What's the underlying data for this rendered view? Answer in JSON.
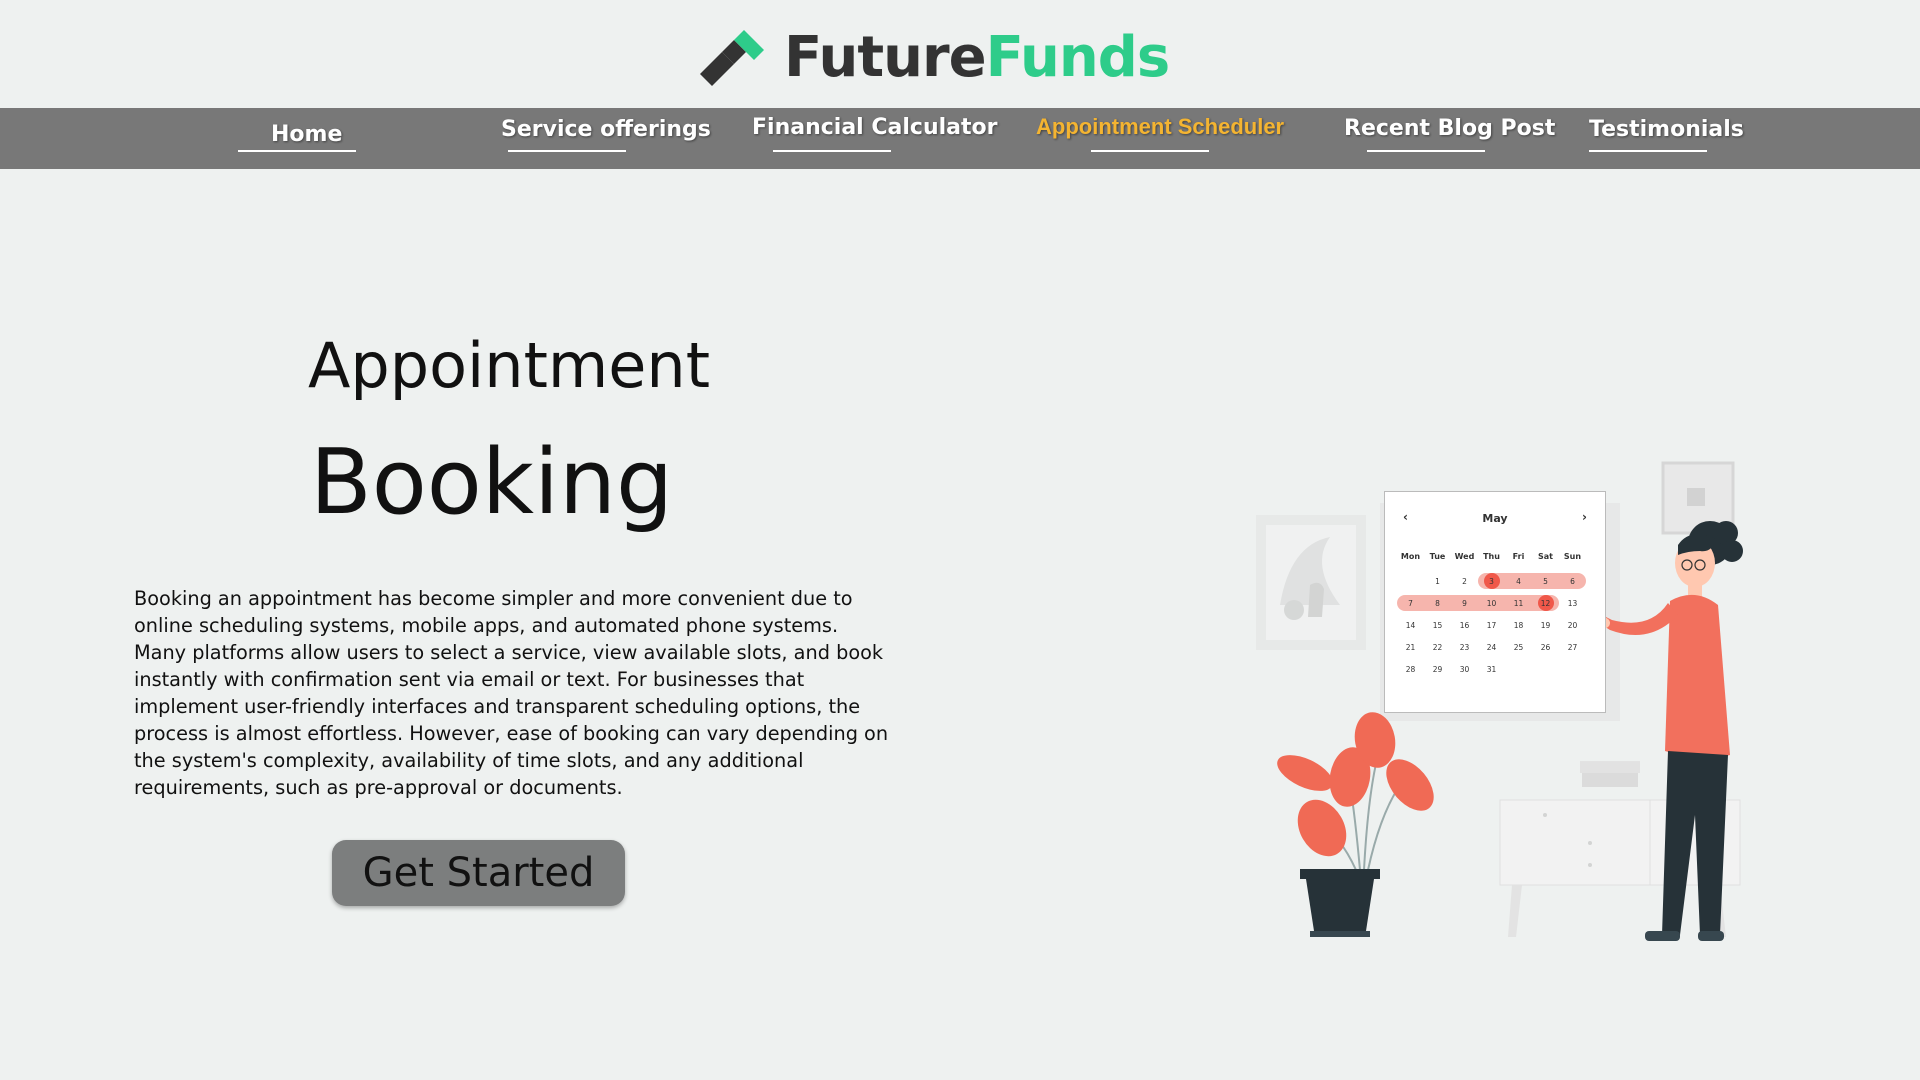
{
  "brand": {
    "name_part1": "Future",
    "name_part2": "Funds",
    "colors": {
      "dark": "#333333",
      "accent": "#2ecc8a",
      "nav_bg": "#787878",
      "nav_active": "#f4b431"
    }
  },
  "nav": {
    "items": [
      {
        "label": "Home",
        "active": false
      },
      {
        "label": "Service offerings",
        "active": false
      },
      {
        "label": "Financial Calculator",
        "active": false
      },
      {
        "label": "Appointment Scheduler",
        "active": true
      },
      {
        "label": "Recent Blog Post",
        "active": false
      },
      {
        "label": "Testimonials",
        "active": false
      }
    ]
  },
  "hero": {
    "title_line1": "Appointment",
    "title_line2": "Booking",
    "description": "Booking an appointment has become simpler and more convenient due to online scheduling systems, mobile apps, and automated phone systems. Many platforms allow users to select a service, view available slots, and book instantly with confirmation sent via email or text. For businesses that implement user-friendly interfaces and transparent scheduling options, the process is almost effortless. However, ease of booking can vary depending on the system's complexity, availability of time slots, and any additional requirements, such as pre-approval or documents.",
    "cta_label": "Get Started"
  },
  "illustration": {
    "calendar": {
      "prev": "‹",
      "next": "›",
      "month": "May",
      "weekdays": [
        "Mon",
        "Tue",
        "Wed",
        "Thu",
        "Fri",
        "Sat",
        "Sun"
      ],
      "rows": [
        [
          "",
          "1",
          "2",
          "3",
          "4",
          "5",
          "6"
        ],
        [
          "7",
          "8",
          "9",
          "10",
          "11",
          "12",
          "13"
        ],
        [
          "14",
          "15",
          "16",
          "17",
          "18",
          "19",
          "20"
        ],
        [
          "21",
          "22",
          "23",
          "24",
          "25",
          "26",
          "27"
        ],
        [
          "28",
          "29",
          "30",
          "31",
          "",
          "",
          ""
        ]
      ],
      "selected": [
        "3",
        "12"
      ]
    }
  }
}
